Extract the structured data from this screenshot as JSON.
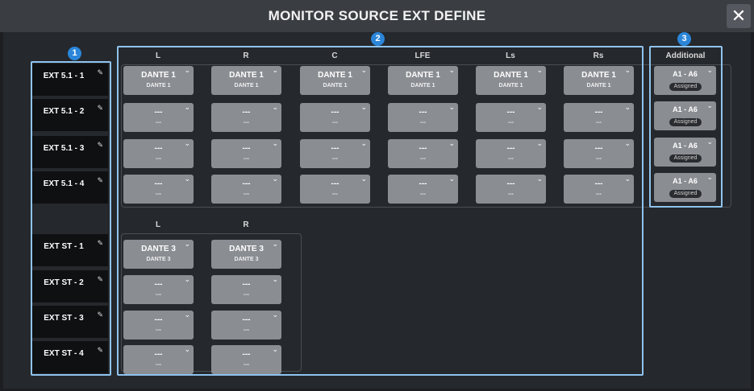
{
  "window": {
    "title": "MONITOR SOURCE EXT DEFINE",
    "close_glyph": "✕"
  },
  "callouts": [
    "1",
    "2",
    "3"
  ],
  "surround": {
    "headers": [
      "L",
      "R",
      "C",
      "LFE",
      "Ls",
      "Rs"
    ],
    "rows": [
      {
        "label": "EXT 5.1 - 1",
        "cells": [
          [
            "DANTE 1",
            "DANTE 1"
          ],
          [
            "DANTE 1",
            "DANTE 1"
          ],
          [
            "DANTE 1",
            "DANTE 1"
          ],
          [
            "DANTE 1",
            "DANTE 1"
          ],
          [
            "DANTE 1",
            "DANTE 1"
          ],
          [
            "DANTE 1",
            "DANTE 1"
          ]
        ]
      },
      {
        "label": "EXT 5.1 - 2",
        "cells": [
          [
            "---",
            "---"
          ],
          [
            "---",
            "---"
          ],
          [
            "---",
            "---"
          ],
          [
            "---",
            "---"
          ],
          [
            "---",
            "---"
          ],
          [
            "---",
            "---"
          ]
        ]
      },
      {
        "label": "EXT 5.1 - 3",
        "cells": [
          [
            "---",
            "---"
          ],
          [
            "---",
            "---"
          ],
          [
            "---",
            "---"
          ],
          [
            "---",
            "---"
          ],
          [
            "---",
            "---"
          ],
          [
            "---",
            "---"
          ]
        ]
      },
      {
        "label": "EXT 5.1 - 4",
        "cells": [
          [
            "---",
            "---"
          ],
          [
            "---",
            "---"
          ],
          [
            "---",
            "---"
          ],
          [
            "---",
            "---"
          ],
          [
            "---",
            "---"
          ],
          [
            "---",
            "---"
          ]
        ]
      }
    ]
  },
  "stereo": {
    "headers": [
      "L",
      "R"
    ],
    "rows": [
      {
        "label": "EXT ST - 1",
        "cells": [
          [
            "DANTE 3",
            "DANTE 3"
          ],
          [
            "DANTE 3",
            "DANTE 3"
          ]
        ]
      },
      {
        "label": "EXT ST - 2",
        "cells": [
          [
            "---",
            "---"
          ],
          [
            "---",
            "---"
          ]
        ]
      },
      {
        "label": "EXT ST - 3",
        "cells": [
          [
            "---",
            "---"
          ],
          [
            "---",
            "---"
          ]
        ]
      },
      {
        "label": "EXT ST - 4",
        "cells": [
          [
            "---",
            "---"
          ],
          [
            "---",
            "---"
          ]
        ]
      }
    ]
  },
  "additional": {
    "header": "Additional",
    "items": [
      {
        "value": "A1 - A6",
        "status": "Assigned"
      },
      {
        "value": "A1 - A6",
        "status": "Assigned"
      },
      {
        "value": "A1 - A6",
        "status": "Assigned"
      },
      {
        "value": "A1 - A6",
        "status": "Assigned"
      }
    ]
  },
  "icons": {
    "dropdown": "chevron-down-icon",
    "edit": "pencil-icon",
    "close": "close-icon"
  },
  "colors": {
    "highlight": "#8fc3ee",
    "badge": "#2b86d9",
    "button": "#8a8d92"
  }
}
